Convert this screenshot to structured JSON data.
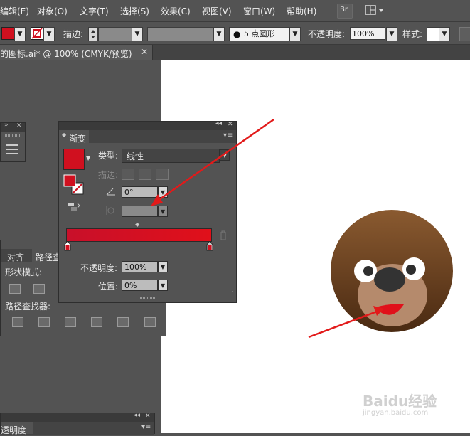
{
  "menubar": {
    "items": [
      "编辑(E)",
      "对象(O)",
      "文字(T)",
      "选择(S)",
      "效果(C)",
      "视图(V)",
      "窗口(W)",
      "帮助(H)"
    ],
    "bridge_label": "Br"
  },
  "control": {
    "stroke_label": "描边:",
    "brush_value": "5 点圆形",
    "opacity_label": "不透明度:",
    "opacity_value": "100%",
    "style_label": "样式:",
    "fill_color": "#d0101f"
  },
  "document_tab": {
    "title": "的图标.ai* @ 100% (CMYK/预览)"
  },
  "gradient_panel": {
    "title": "渐变",
    "type_label": "类型:",
    "type_value": "线性",
    "stroke_label": "描边:",
    "angle_value": "0°",
    "opacity_label": "不透明度:",
    "opacity_value": "100%",
    "position_label": "位置:",
    "position_value": "0%",
    "stop_color": "#d0101f"
  },
  "pathfinder_panel": {
    "tab_align": "对齐",
    "tab_pathfinder": "路径查",
    "shape_modes_label": "形状模式:",
    "pathfinders_label": "路径查找器:"
  },
  "bottom_panel": {
    "title": "透明度"
  },
  "artwork": {
    "face_top_color": "#8a5a30",
    "face_bottom_color": "#4a2a12",
    "muzzle_color": "#b58a6c",
    "mouth_color": "#e0101a",
    "nose_color": "#333333"
  },
  "watermark": {
    "text": "Baidu经验",
    "sub": "jingyan.baidu.com"
  }
}
